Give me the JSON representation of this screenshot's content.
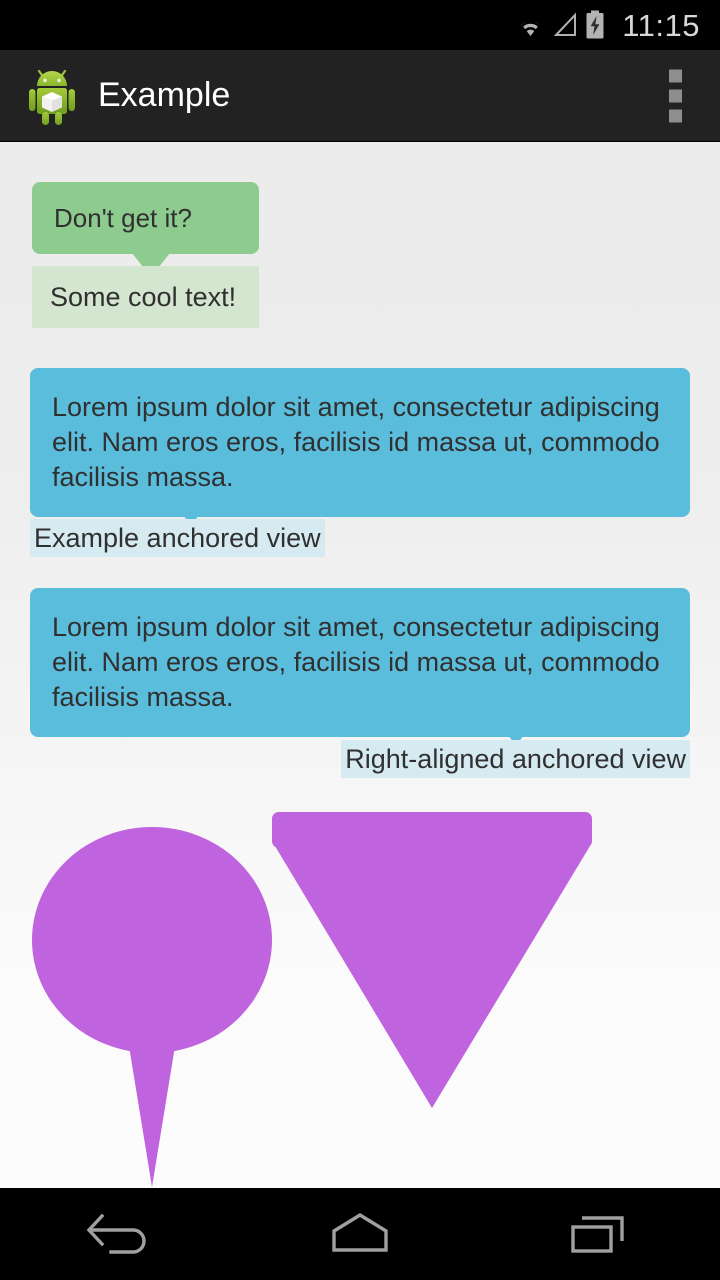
{
  "statusbar": {
    "time": "11:15",
    "icons": [
      "wifi-icon",
      "signal-icon",
      "battery-charging-icon"
    ]
  },
  "actionbar": {
    "logo": "android-robot-icon",
    "title": "Example",
    "overflow": "overflow-menu-icon"
  },
  "content": {
    "green_bubble": {
      "text": "Don't get it?",
      "color": "#8ecb8e"
    },
    "green_anchor": {
      "text": "Some cool text!",
      "color": "#d4e6d0"
    },
    "blue_bubble_one": {
      "text": "Lorem ipsum dolor sit amet, consectetur adipiscing elit. Nam eros eros, facilisis id massa ut, commodo facilisis massa.",
      "color": "#5bbddc"
    },
    "blue_anchor_one": {
      "text": "Example anchored view",
      "color": "#d6eaf2"
    },
    "blue_bubble_two": {
      "text": "Lorem ipsum dolor sit amet, consectetur adipiscing elit. Nam eros eros, facilisis id massa ut, commodo facilisis massa.",
      "color": "#5bbddc"
    },
    "blue_anchor_two": {
      "text": "Right-aligned anchored view",
      "color": "#d6eaf2"
    },
    "purple_oval": {
      "color": "#bf63de"
    },
    "purple_arrow": {
      "color": "#bf63de"
    }
  },
  "navbar": {
    "back": "back-icon",
    "home": "home-icon",
    "recents": "recents-icon"
  },
  "colors": {
    "accent_green": "#8ecb8e",
    "accent_green_light": "#d4e6d0",
    "accent_blue": "#5bbddc",
    "accent_blue_light": "#d6eaf2",
    "accent_purple": "#bf63de",
    "actionbar_bg": "#222222",
    "page_bg": "#ececec",
    "text": "#303030"
  }
}
